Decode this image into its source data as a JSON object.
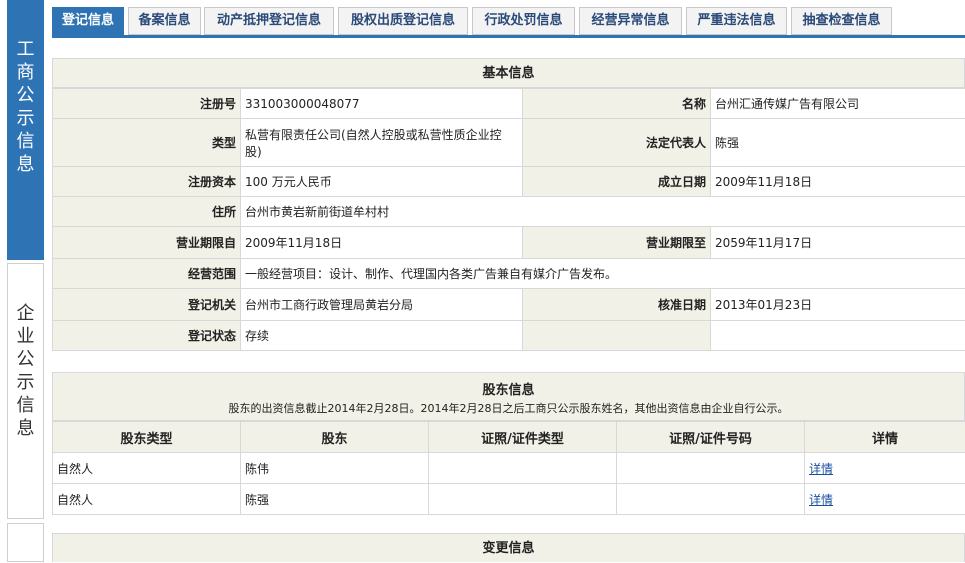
{
  "sidebar": {
    "active_label": "工商公示信息",
    "inactive_label": "企业公示信息"
  },
  "tabs": [
    "登记信息",
    "备案信息",
    "动产抵押登记信息",
    "股权出质登记信息",
    "行政处罚信息",
    "经营异常信息",
    "严重违法信息",
    "抽查检查信息"
  ],
  "basic": {
    "title": "基本信息",
    "reg_no_label": "注册号",
    "reg_no": "331003000048077",
    "name_label": "名称",
    "name": "台州汇通传媒广告有限公司",
    "type_label": "类型",
    "type": "私营有限责任公司(自然人控股或私营性质企业控股)",
    "rep_label": "法定代表人",
    "rep": "陈强",
    "capital_label": "注册资本",
    "capital": "100 万元人民币",
    "founded_label": "成立日期",
    "founded": "2009年11月18日",
    "address_label": "住所",
    "address": "台州市黄岩新前街道牟村村",
    "term_from_label": "营业期限自",
    "term_from": "2009年11月18日",
    "term_to_label": "营业期限至",
    "term_to": "2059年11月17日",
    "scope_label": "经营范围",
    "scope": "一般经营项目：设计、制作、代理国内各类广告兼自有媒介广告发布。",
    "authority_label": "登记机关",
    "authority": "台州市工商行政管理局黄岩分局",
    "approved_label": "核准日期",
    "approved": "2013年01月23日",
    "status_label": "登记状态",
    "status": "存续"
  },
  "shareholders": {
    "title": "股东信息",
    "note": "股东的出资信息截止2014年2月28日。2014年2月28日之后工商只公示股东姓名，其他出资信息由企业自行公示。",
    "headers": [
      "股东类型",
      "股东",
      "证照/证件类型",
      "证照/证件号码",
      "详情"
    ],
    "rows": [
      {
        "type": "自然人",
        "name": "陈伟",
        "id_type": "",
        "id_no": "",
        "detail": "详情"
      },
      {
        "type": "自然人",
        "name": "陈强",
        "id_type": "",
        "id_no": "",
        "detail": "详情"
      }
    ]
  },
  "changes": {
    "title": "变更信息"
  }
}
